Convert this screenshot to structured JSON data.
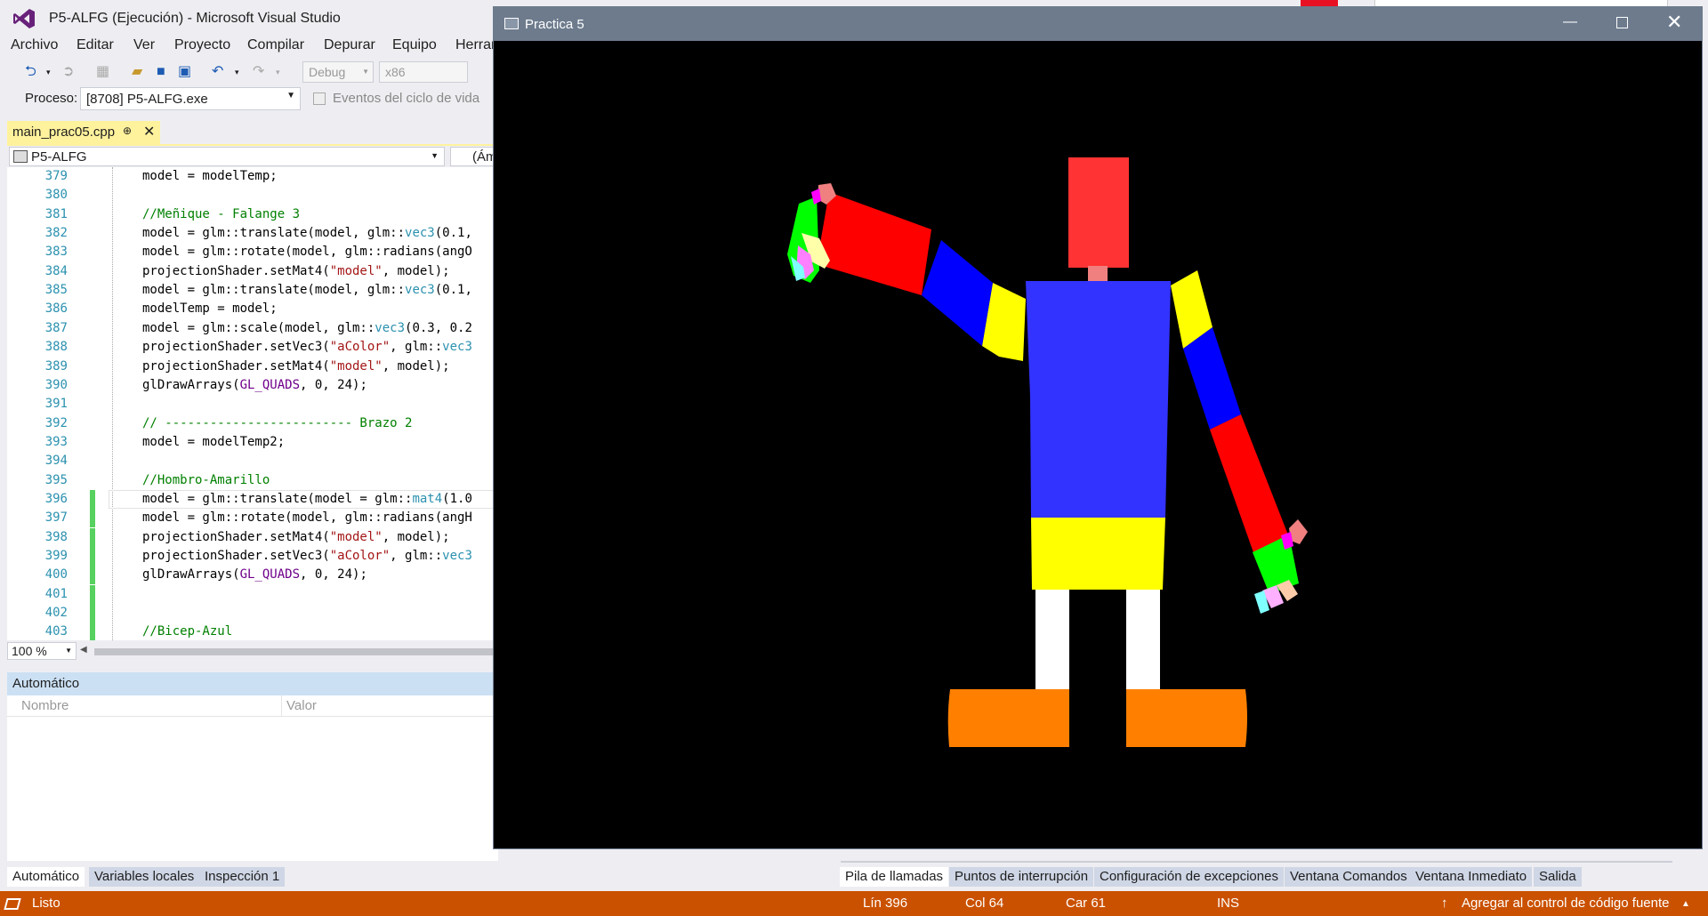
{
  "vs": {
    "title": "P5-ALFG (Ejecución) - Microsoft Visual Studio",
    "menu": [
      "Archivo",
      "Editar",
      "Ver",
      "Proyecto",
      "Compilar",
      "Depurar",
      "Equipo",
      "Herran"
    ],
    "toolbar": {
      "config": "Debug",
      "platform": "x86"
    },
    "process": {
      "label": "Proceso:",
      "value": "[8708] P5-ALFG.exe",
      "lifecycle": "Eventos del ciclo de vida"
    },
    "doc_tab": {
      "label": "main_prac05.cpp",
      "pin": "⊕",
      "close": "✕"
    },
    "nav": {
      "project": "P5-ALFG",
      "scope": "(Ám"
    },
    "zoom": "100 %"
  },
  "code": [
    {
      "n": "379",
      "tokens": [
        {
          "t": "model = modelTemp;",
          "c": ""
        }
      ]
    },
    {
      "n": "380",
      "tokens": []
    },
    {
      "n": "381",
      "tokens": [
        {
          "t": "//Meñique - Falange 3",
          "c": "cm"
        }
      ]
    },
    {
      "n": "382",
      "tokens": [
        {
          "t": "model = glm::translate(model, glm::",
          "c": ""
        },
        {
          "t": "vec3",
          "c": "ty"
        },
        {
          "t": "(0.1,",
          "c": ""
        }
      ]
    },
    {
      "n": "383",
      "tokens": [
        {
          "t": "model = glm::rotate(model, glm::radians(angO",
          "c": ""
        }
      ]
    },
    {
      "n": "384",
      "tokens": [
        {
          "t": "projectionShader.setMat4(",
          "c": ""
        },
        {
          "t": "\"model\"",
          "c": "str"
        },
        {
          "t": ", model);",
          "c": ""
        }
      ]
    },
    {
      "n": "385",
      "tokens": [
        {
          "t": "model = glm::translate(model, glm::",
          "c": ""
        },
        {
          "t": "vec3",
          "c": "ty"
        },
        {
          "t": "(0.1,",
          "c": ""
        }
      ]
    },
    {
      "n": "386",
      "tokens": [
        {
          "t": "modelTemp = model;",
          "c": ""
        }
      ]
    },
    {
      "n": "387",
      "tokens": [
        {
          "t": "model = glm::scale(model, glm::",
          "c": ""
        },
        {
          "t": "vec3",
          "c": "ty"
        },
        {
          "t": "(0.3, 0.2",
          "c": ""
        }
      ]
    },
    {
      "n": "388",
      "tokens": [
        {
          "t": "projectionShader.setVec3(",
          "c": ""
        },
        {
          "t": "\"aColor\"",
          "c": "str"
        },
        {
          "t": ", glm::",
          "c": ""
        },
        {
          "t": "vec3",
          "c": "ty"
        }
      ]
    },
    {
      "n": "389",
      "tokens": [
        {
          "t": "projectionShader.setMat4(",
          "c": ""
        },
        {
          "t": "\"model\"",
          "c": "str"
        },
        {
          "t": ", model);",
          "c": ""
        }
      ]
    },
    {
      "n": "390",
      "tokens": [
        {
          "t": "glDrawArrays(",
          "c": ""
        },
        {
          "t": "GL_QUADS",
          "c": "mc"
        },
        {
          "t": ", 0, 24);",
          "c": ""
        }
      ]
    },
    {
      "n": "391",
      "tokens": []
    },
    {
      "n": "392",
      "tokens": [
        {
          "t": "// ------------------------- Brazo 2",
          "c": "cm"
        }
      ]
    },
    {
      "n": "393",
      "tokens": [
        {
          "t": "model = modelTemp2;",
          "c": ""
        }
      ]
    },
    {
      "n": "394",
      "tokens": []
    },
    {
      "n": "395",
      "tokens": [
        {
          "t": "//Hombro-Amarillo",
          "c": "cm"
        }
      ]
    },
    {
      "n": "396",
      "tokens": [
        {
          "t": "model = glm::translate(model = glm::",
          "c": ""
        },
        {
          "t": "mat4",
          "c": "ty"
        },
        {
          "t": "(1.0",
          "c": ""
        }
      ],
      "changed": true,
      "current": true
    },
    {
      "n": "397",
      "tokens": [
        {
          "t": "model = glm::rotate(model, glm::radians(angH",
          "c": ""
        }
      ],
      "changed": true
    },
    {
      "n": "398",
      "tokens": [
        {
          "t": "projectionShader.setMat4(",
          "c": ""
        },
        {
          "t": "\"model\"",
          "c": "str"
        },
        {
          "t": ", model);",
          "c": ""
        }
      ],
      "changed": true
    },
    {
      "n": "399",
      "tokens": [
        {
          "t": "projectionShader.setVec3(",
          "c": ""
        },
        {
          "t": "\"aColor\"",
          "c": "str"
        },
        {
          "t": ", glm::",
          "c": ""
        },
        {
          "t": "vec3",
          "c": "ty"
        }
      ],
      "changed": true
    },
    {
      "n": "400",
      "tokens": [
        {
          "t": "glDrawArrays(",
          "c": ""
        },
        {
          "t": "GL_QUADS",
          "c": "mc"
        },
        {
          "t": ", 0, 24);",
          "c": ""
        }
      ],
      "changed": true
    },
    {
      "n": "401",
      "tokens": [],
      "changed": true
    },
    {
      "n": "402",
      "tokens": [],
      "changed": true
    },
    {
      "n": "403",
      "tokens": [
        {
          "t": "//Bicep-Azul",
          "c": "cm"
        }
      ],
      "changed": true
    }
  ],
  "autos": {
    "title": "Automático",
    "col_name": "Nombre",
    "col_value": "Valor"
  },
  "bottom_tabs_left": [
    "Automático",
    "Variables locales",
    "Inspección 1"
  ],
  "bottom_tabs_right": [
    "Pila de llamadas",
    "Puntos de interrupción",
    "Configuración de excepciones",
    "Ventana Comandos",
    "Ventana Inmediato",
    "Salida"
  ],
  "status": {
    "ready": "Listo",
    "line": "Lín 396",
    "col": "Col 64",
    "char": "Car 61",
    "ins": "INS",
    "source_control": "Agregar al control de código fuente",
    "color": "#ca5100"
  },
  "gl_window": {
    "title": "Practica 5",
    "figure_colors": {
      "head": "#ff3333",
      "neck": "#f08080",
      "torso": "#3333ff",
      "shorts": "#ffff00",
      "legs": "#ffffff",
      "feet": "#ff8000",
      "shoulder": "#ffff00",
      "bicep": "#0000ff",
      "forearm": "#ff0000",
      "palm": "#00ff00"
    }
  }
}
